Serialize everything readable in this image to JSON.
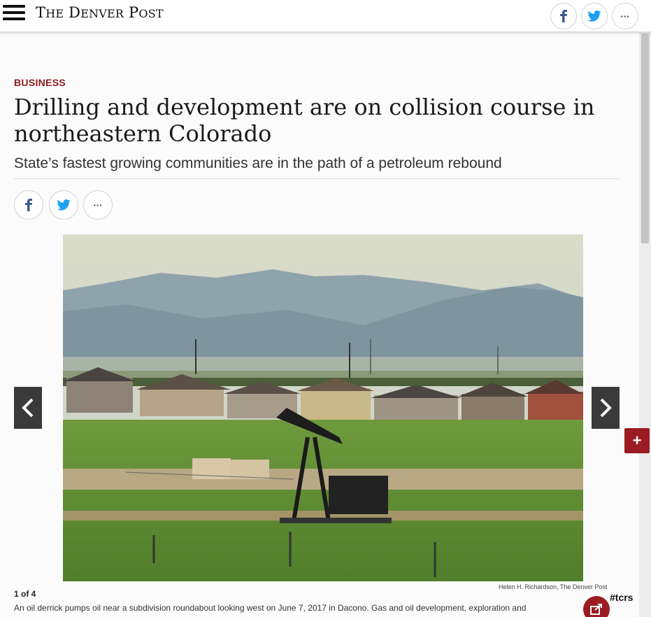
{
  "header": {
    "logo_first": "T",
    "logo_he": "HE",
    "logo_d": " D",
    "logo_enver": "ENVER",
    "logo_p": " P",
    "logo_ost": "OST",
    "more_label": "···"
  },
  "article": {
    "category": "BUSINESS",
    "headline": "Drilling and development are on collision course in northeastern Colorado",
    "dek": "State’s fastest growing communities are in the path of a petroleum rebound",
    "share_more_label": "···"
  },
  "gallery": {
    "counter": "1 of 4",
    "credit": "Helen H. Richardson, The Denver Post",
    "caption": "An oil derrick pumps oil near a subdivision roundabout looking west on June 7, 2017 in Dacono. Gas and oil development, exploration and",
    "plus_label": "+",
    "tcrs_label": "#tcrs"
  },
  "colors": {
    "brand_red": "#9b1b23",
    "category_red": "#8b1a1e",
    "facebook_blue": "#3b5998",
    "twitter_blue": "#1da1f2"
  }
}
